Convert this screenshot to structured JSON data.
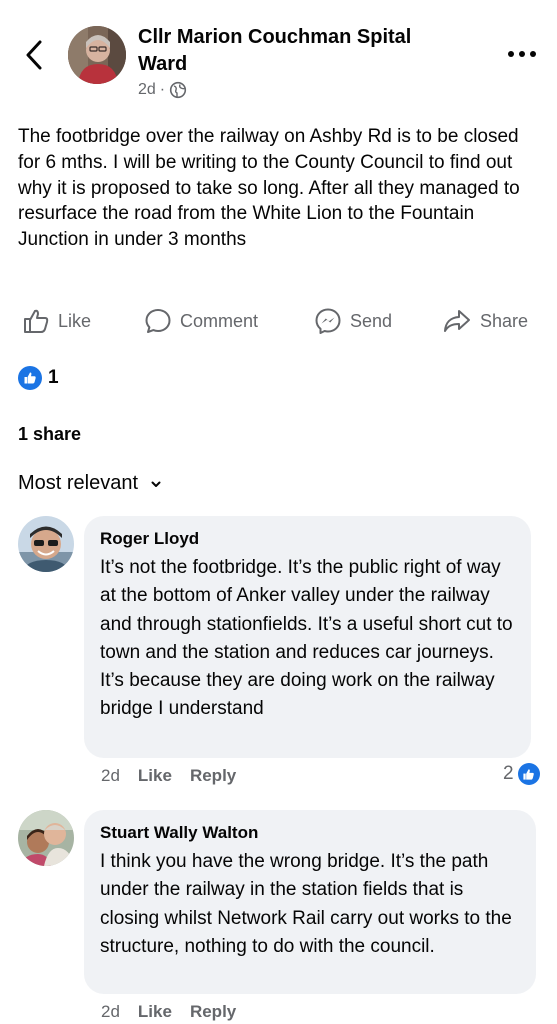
{
  "post": {
    "author": "Cllr Marion Couchman Spital Ward",
    "time": "2d",
    "text": "The footbridge over the railway on Ashby Rd is to be closed for 6 mths. I will be writing to the County Council to find out why it is proposed to take so long. After all they managed to resurface the road from the White Lion to the Fountain Junction in under 3 months"
  },
  "actions": {
    "like": "Like",
    "comment": "Comment",
    "send": "Send",
    "share": "Share"
  },
  "reactions": {
    "count": "1"
  },
  "shares": "1 share",
  "sort": {
    "label": "Most relevant"
  },
  "comments": [
    {
      "name": "Roger Lloyd",
      "text": "It’s not the footbridge. It’s the public right of way at the bottom of Anker valley under the railway and through stationfields. It’s a useful short cut to town and the station and reduces car journeys. It’s because they are doing work on the railway bridge I understand",
      "time": "2d",
      "like": "Like",
      "reply": "Reply",
      "reactions": "2"
    },
    {
      "name": "Stuart Wally Walton",
      "text": "I think you have the wrong bridge. It’s the path under the railway in the station fields that is closing whilst Network Rail carry out works to the structure, nothing to do with the council.",
      "time": "2d",
      "like": "Like",
      "reply": "Reply"
    }
  ],
  "icons": {
    "back": "chevron-left-icon",
    "more": "more-horizontal-icon",
    "privacy": "globe-icon",
    "like": "thumbs-up-icon",
    "comment": "speech-bubble-icon",
    "send": "messenger-icon",
    "share": "share-arrow-icon",
    "sort": "chevron-down-icon"
  },
  "colors": {
    "accent": "#1b74e4",
    "secondary_text": "#65676b",
    "bubble": "#f0f2f5"
  }
}
